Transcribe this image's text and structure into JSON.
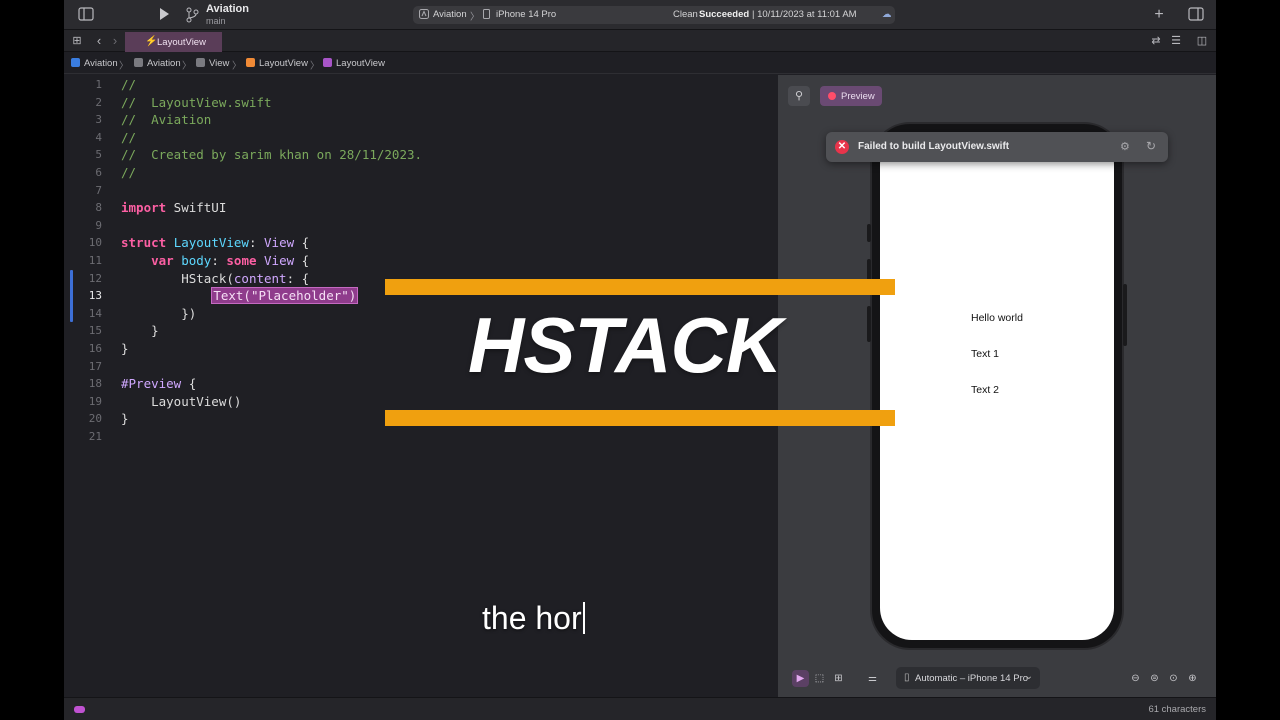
{
  "titlebar": {
    "project_name": "Aviation",
    "branch": "main",
    "scheme": "Aviation",
    "scheme_sep": "〉",
    "device": "iPhone 14 Pro",
    "status_prefix": "Clean",
    "status_main": "Succeeded",
    "status_time": "| 10/11/2023 at 11:01 AM"
  },
  "tab": {
    "label": "LayoutView"
  },
  "breadcrumb": {
    "items": [
      "Aviation",
      "Aviation",
      "View",
      "LayoutView",
      "LayoutView"
    ],
    "sep": "〉"
  },
  "editor": {
    "lines": [
      {
        "n": "1",
        "segments": [
          {
            "c": "cm",
            "t": "//"
          }
        ]
      },
      {
        "n": "2",
        "segments": [
          {
            "c": "cm",
            "t": "//  LayoutView.swift"
          }
        ]
      },
      {
        "n": "3",
        "segments": [
          {
            "c": "cm",
            "t": "//  Aviation"
          }
        ]
      },
      {
        "n": "4",
        "segments": [
          {
            "c": "cm",
            "t": "//"
          }
        ]
      },
      {
        "n": "5",
        "segments": [
          {
            "c": "cm",
            "t": "//  Created by sarim khan on 28/11/2023."
          }
        ]
      },
      {
        "n": "6",
        "segments": [
          {
            "c": "cm",
            "t": "//"
          }
        ]
      },
      {
        "n": "7",
        "segments": []
      },
      {
        "n": "8",
        "segments": [
          {
            "c": "kw",
            "t": "import"
          },
          {
            "c": "",
            "t": " SwiftUI"
          }
        ]
      },
      {
        "n": "9",
        "segments": []
      },
      {
        "n": "10",
        "segments": [
          {
            "c": "kw",
            "t": "struct"
          },
          {
            "c": "",
            "t": " "
          },
          {
            "c": "ty",
            "t": "LayoutView"
          },
          {
            "c": "",
            "t": ": "
          },
          {
            "c": "ty2",
            "t": "View"
          },
          {
            "c": "",
            "t": " {"
          }
        ]
      },
      {
        "n": "11",
        "segments": [
          {
            "c": "",
            "t": "    "
          },
          {
            "c": "kw",
            "t": "var"
          },
          {
            "c": "",
            "t": " "
          },
          {
            "c": "ty",
            "t": "body"
          },
          {
            "c": "",
            "t": ": "
          },
          {
            "c": "kw",
            "t": "some"
          },
          {
            "c": "",
            "t": " "
          },
          {
            "c": "ty2",
            "t": "View"
          },
          {
            "c": "",
            "t": " {"
          }
        ]
      },
      {
        "n": "12",
        "segments": [
          {
            "c": "",
            "t": "        HStack("
          },
          {
            "c": "fn",
            "t": "content"
          },
          {
            "c": "",
            "t": ": {"
          }
        ]
      },
      {
        "n": "13",
        "segments": [
          {
            "c": "",
            "t": "            "
          },
          {
            "c": "sel",
            "t": "Text(\"Placeholder\")"
          }
        ]
      },
      {
        "n": "14",
        "segments": [
          {
            "c": "",
            "t": "        })"
          }
        ]
      },
      {
        "n": "15",
        "segments": [
          {
            "c": "",
            "t": "    }"
          }
        ]
      },
      {
        "n": "16",
        "segments": [
          {
            "c": "",
            "t": "}"
          }
        ]
      },
      {
        "n": "17",
        "segments": []
      },
      {
        "n": "18",
        "segments": [
          {
            "c": "fn",
            "t": "#Preview"
          },
          {
            "c": "",
            "t": " {"
          }
        ]
      },
      {
        "n": "19",
        "segments": [
          {
            "c": "",
            "t": "    LayoutView()"
          }
        ]
      },
      {
        "n": "20",
        "segments": [
          {
            "c": "",
            "t": "}"
          }
        ]
      },
      {
        "n": "21",
        "segments": []
      }
    ],
    "current_line": "13"
  },
  "canvas": {
    "preview_label": "Preview",
    "error_message": "Failed to build LayoutView.swift",
    "phone_texts": [
      "Hello world",
      "Text 1",
      "Text 2"
    ],
    "device_select": "Automatic – iPhone 14 Pro"
  },
  "statusbar": {
    "char_count": "61 characters"
  },
  "overlay": {
    "headline": "HSTACK",
    "subtitle": "the hor",
    "accent_color": "#f0a00f"
  }
}
